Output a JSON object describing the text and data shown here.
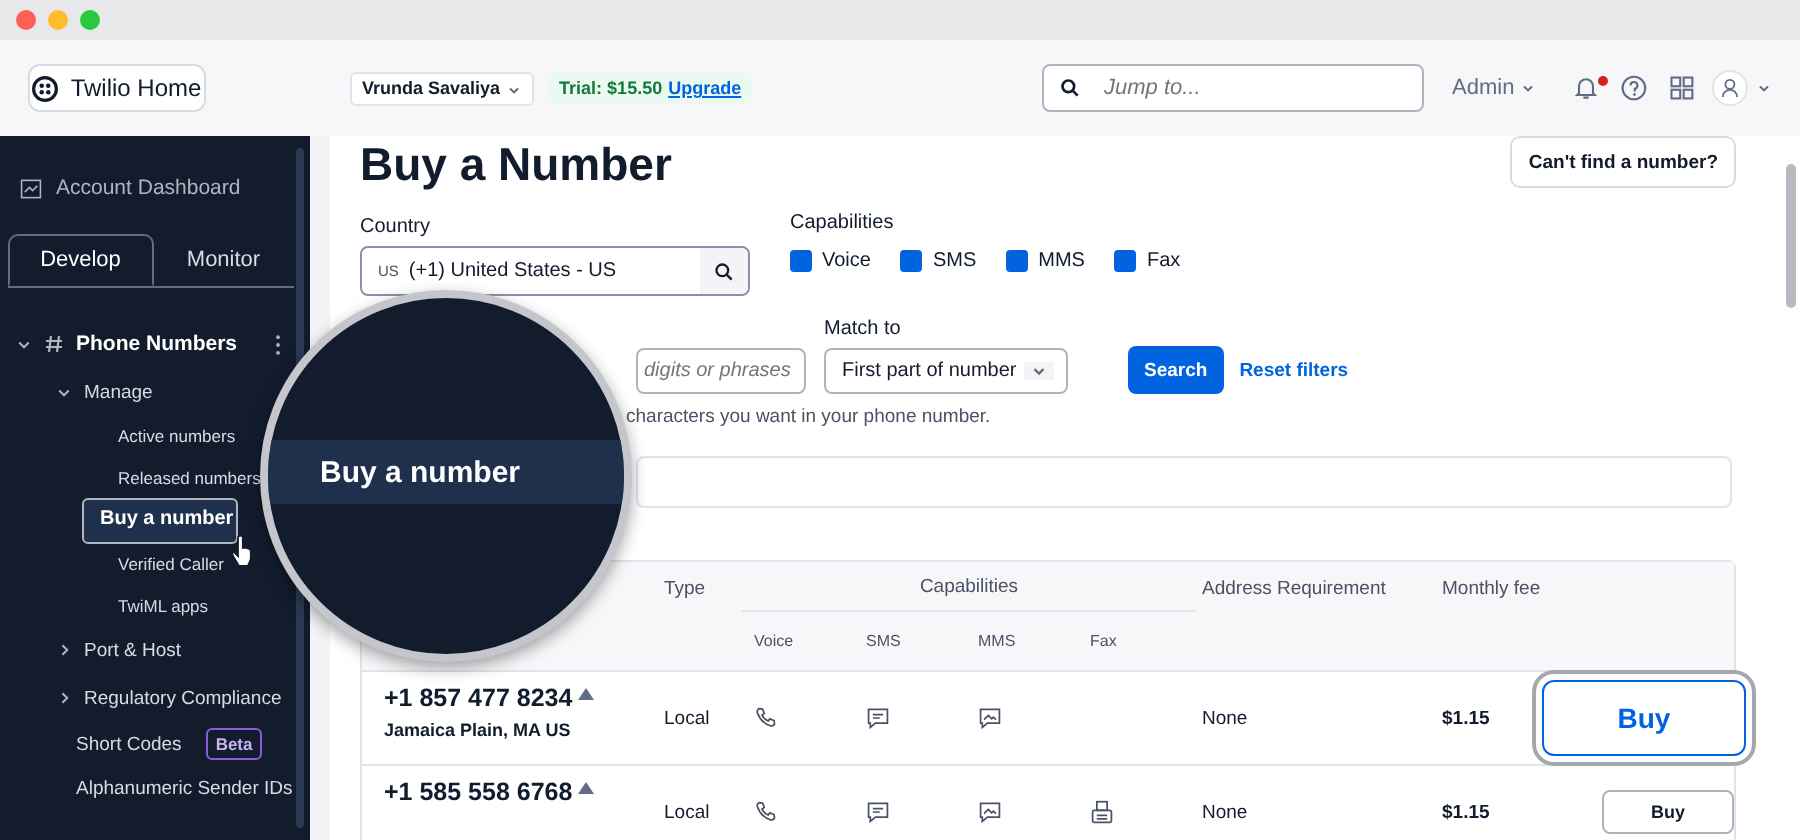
{
  "top_bar": {
    "home_button": "Twilio Home",
    "account": "Vrunda Savaliya",
    "trial": {
      "text": "Trial: $15.50",
      "link": "Upgrade"
    },
    "search": {
      "placeholder": "Jump to..."
    },
    "role": "Admin",
    "notification_unread": true
  },
  "sidebar": {
    "dashboard": "Account Dashboard",
    "tabs": [
      {
        "label": "Develop",
        "selected": true
      },
      {
        "label": "Monitor",
        "selected": false
      }
    ],
    "items": [
      {
        "label": "Phone Numbers",
        "expanded": true,
        "children": [
          {
            "label": "Manage",
            "kind": "group",
            "expanded": true,
            "children": [
              {
                "label": "Active numbers",
                "selected": false
              },
              {
                "label": "Released numbers",
                "selected": false
              },
              {
                "label": "Buy a number",
                "selected": true
              },
              {
                "label": "Verified Caller",
                "selected": false
              },
              {
                "label": "TwiML apps",
                "selected": false
              }
            ]
          },
          {
            "label": "Port & Host",
            "kind": "group",
            "expanded": false
          },
          {
            "label": "Regulatory Compliance",
            "kind": "group",
            "expanded": false
          },
          {
            "label": "Short Codes",
            "kind": "link",
            "badge": "Beta"
          },
          {
            "label": "Alphanumeric Sender IDs",
            "kind": "link"
          }
        ]
      }
    ]
  },
  "magnifier": {
    "label": "Buy a number"
  },
  "page": {
    "title": "Buy a Number",
    "help_button": "Can't find a number?",
    "country": {
      "label": "Country",
      "code": "US",
      "value": "(+1) United States - US"
    },
    "capabilities": {
      "label": "Capabilities",
      "options": [
        {
          "label": "Voice",
          "checked": true
        },
        {
          "label": "SMS",
          "checked": true
        },
        {
          "label": "MMS",
          "checked": true
        },
        {
          "label": "Fax",
          "checked": true
        }
      ]
    },
    "number_field": {
      "placeholder": "digits or phrases"
    },
    "match": {
      "label": "Match to",
      "value": "First part of number"
    },
    "search_button": "Search",
    "reset_link": "Reset filters",
    "hint": "characters you want in your phone number."
  },
  "table": {
    "columns": {
      "type": "Type",
      "capabilities": "Capabilities",
      "voice": "Voice",
      "sms": "SMS",
      "mms": "MMS",
      "fax": "Fax",
      "address": "Address Requirement",
      "fee": "Monthly fee"
    },
    "rows": [
      {
        "number": "+1 857 477 8234",
        "location": "Jamaica Plain, MA US",
        "type": "Local",
        "voice": true,
        "sms": true,
        "mms": true,
        "fax": false,
        "address": "None",
        "fee": "$1.15",
        "button": "Buy",
        "highlighted": true
      },
      {
        "number": "+1 585 558 6768",
        "type": "Local",
        "voice": true,
        "sms": true,
        "mms": true,
        "fax": true,
        "address": "None",
        "fee": "$1.15",
        "button": "Buy",
        "highlighted": false
      }
    ]
  }
}
